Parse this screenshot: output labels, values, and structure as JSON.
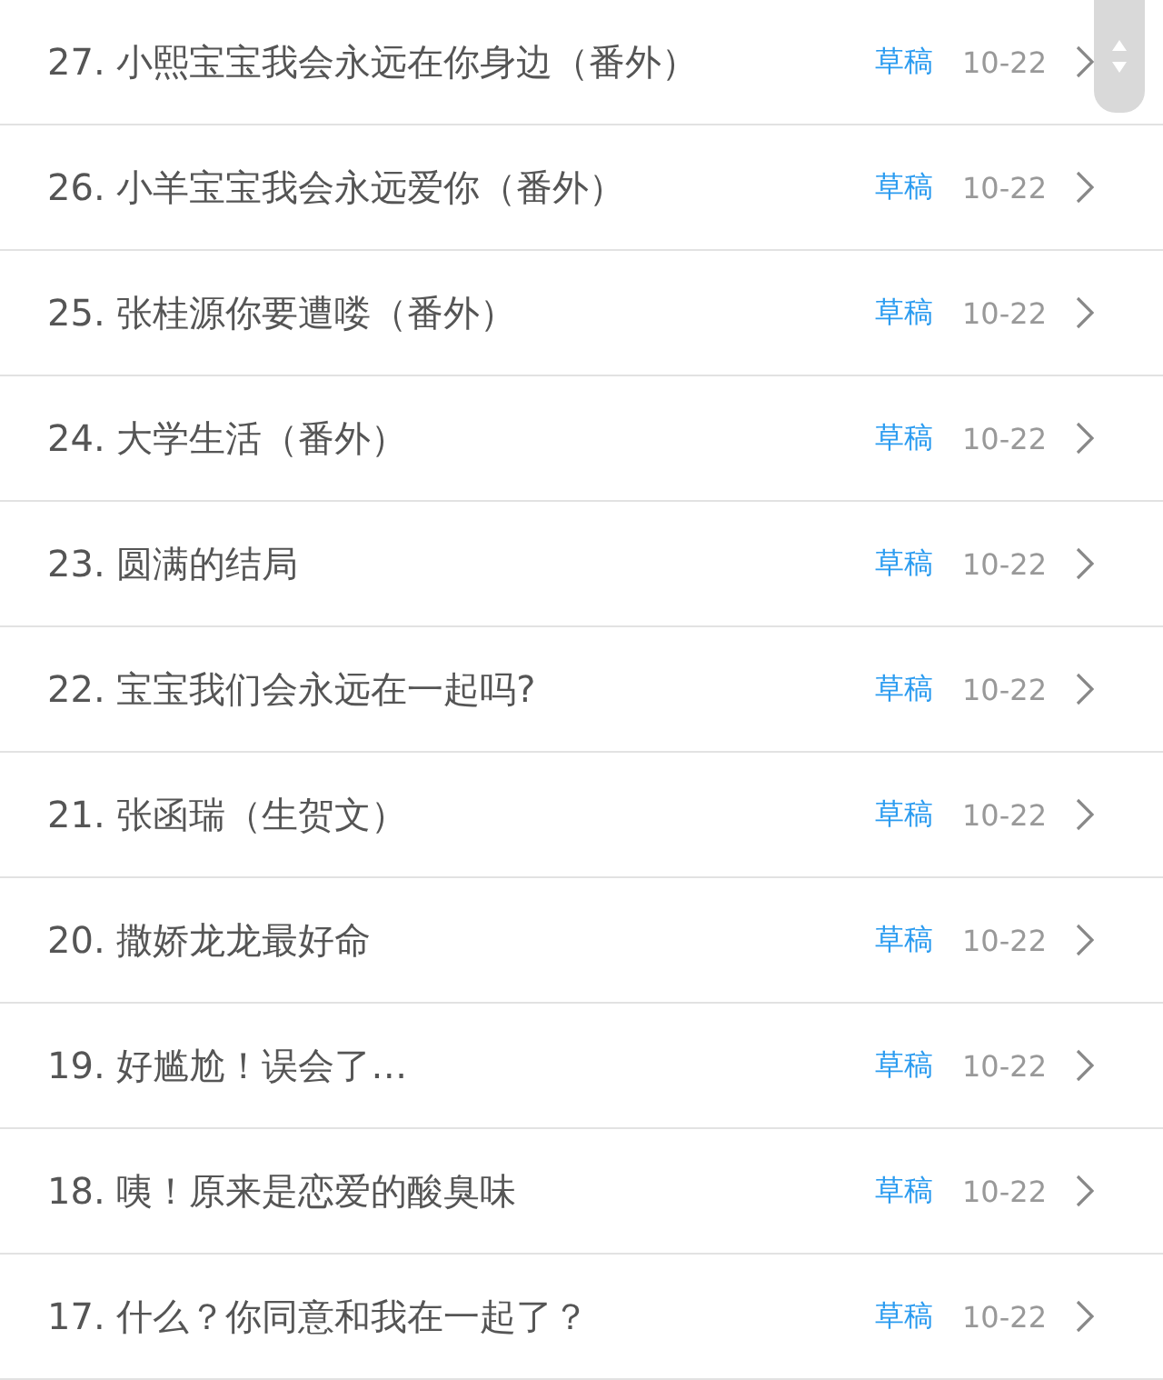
{
  "chapters": [
    {
      "title": "27. 小熙宝宝我会永远在你身边（番外）",
      "status": "草稿",
      "date": "10-22"
    },
    {
      "title": "26. 小羊宝宝我会永远爱你（番外）",
      "status": "草稿",
      "date": "10-22"
    },
    {
      "title": "25. 张桂源你要遭喽（番外）",
      "status": "草稿",
      "date": "10-22"
    },
    {
      "title": "24. 大学生活（番外）",
      "status": "草稿",
      "date": "10-22"
    },
    {
      "title": "23. 圆满的结局",
      "status": "草稿",
      "date": "10-22"
    },
    {
      "title": "22. 宝宝我们会永远在一起吗?",
      "status": "草稿",
      "date": "10-22"
    },
    {
      "title": "21. 张函瑞（生贺文）",
      "status": "草稿",
      "date": "10-22"
    },
    {
      "title": "20. 撒娇龙龙最好命",
      "status": "草稿",
      "date": "10-22"
    },
    {
      "title": "19. 好尴尬！误会了…",
      "status": "草稿",
      "date": "10-22"
    },
    {
      "title": "18. 咦！原来是恋爱的酸臭味",
      "status": "草稿",
      "date": "10-22"
    },
    {
      "title": "17. 什么？你同意和我在一起了？",
      "status": "草稿",
      "date": "10-22"
    }
  ]
}
